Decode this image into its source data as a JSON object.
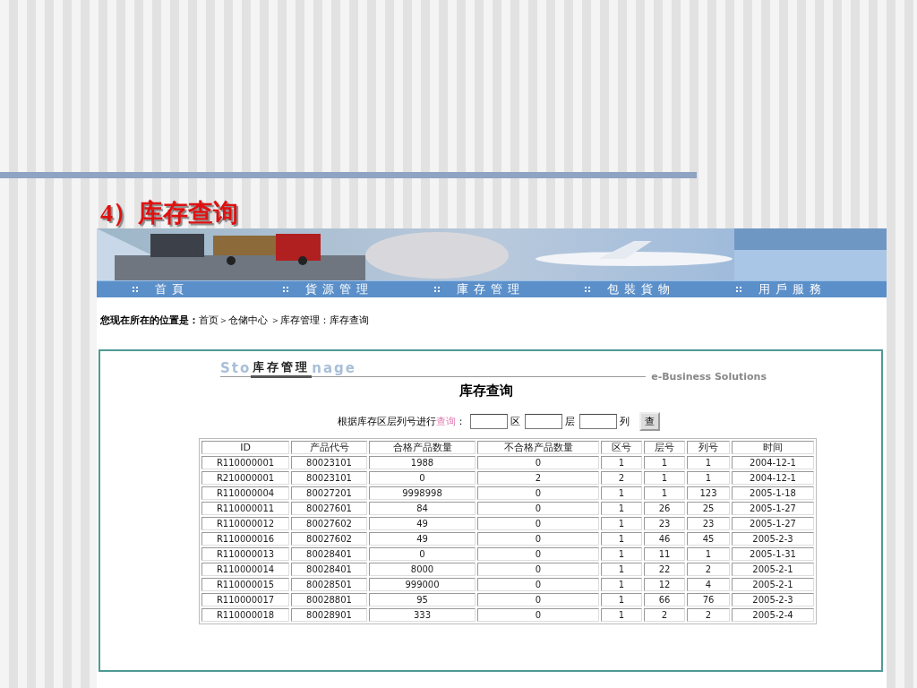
{
  "slide_title": "4）库存查询",
  "nav": {
    "items": [
      {
        "label": "首頁",
        "selected": false
      },
      {
        "label": "貨源管理",
        "selected": false
      },
      {
        "label": "庫存管理",
        "selected": false
      },
      {
        "label": "包裝貨物",
        "selected": false
      },
      {
        "label": "用戶服務",
        "selected": false
      }
    ]
  },
  "breadcrumb": {
    "label": "您现在所在的位置是：",
    "path": "首页＞仓储中心 ＞库存管理：库存查询"
  },
  "section_header": {
    "backdrop_left": "Sto",
    "title": "库存管理",
    "backdrop_right": "nage",
    "tagline": "e-Business Solutions"
  },
  "page_title": "库存查询",
  "search": {
    "prompt": "根据库存区层列号进行",
    "link": "查询",
    "colon": "：",
    "fields": [
      {
        "unit": "区"
      },
      {
        "unit": "层"
      },
      {
        "unit": "列"
      }
    ],
    "button": "查"
  },
  "table": {
    "columns": [
      "ID",
      "产品代号",
      "合格产品数量",
      "不合格产品数量",
      "区号",
      "层号",
      "列号",
      "时间"
    ],
    "rows": [
      [
        "R110000001",
        "80023101",
        "1988",
        "0",
        "1",
        "1",
        "1",
        "2004-12-1"
      ],
      [
        "R210000001",
        "80023101",
        "0",
        "2",
        "2",
        "1",
        "1",
        "2004-12-1"
      ],
      [
        "R110000004",
        "80027201",
        "9998998",
        "0",
        "1",
        "1",
        "123",
        "2005-1-18"
      ],
      [
        "R110000011",
        "80027601",
        "84",
        "0",
        "1",
        "26",
        "25",
        "2005-1-27"
      ],
      [
        "R110000012",
        "80027602",
        "49",
        "0",
        "1",
        "23",
        "23",
        "2005-1-27"
      ],
      [
        "R110000016",
        "80027602",
        "49",
        "0",
        "1",
        "46",
        "45",
        "2005-2-3"
      ],
      [
        "R110000013",
        "80028401",
        "0",
        "0",
        "1",
        "11",
        "1",
        "2005-1-31"
      ],
      [
        "R110000014",
        "80028401",
        "8000",
        "0",
        "1",
        "22",
        "2",
        "2005-2-1"
      ],
      [
        "R110000015",
        "80028501",
        "999000",
        "0",
        "1",
        "12",
        "4",
        "2005-2-1"
      ],
      [
        "R110000017",
        "80028801",
        "95",
        "0",
        "1",
        "66",
        "76",
        "2005-2-3"
      ],
      [
        "R110000018",
        "80028901",
        "333",
        "0",
        "1",
        "2",
        "2",
        "2005-2-4"
      ]
    ]
  }
}
